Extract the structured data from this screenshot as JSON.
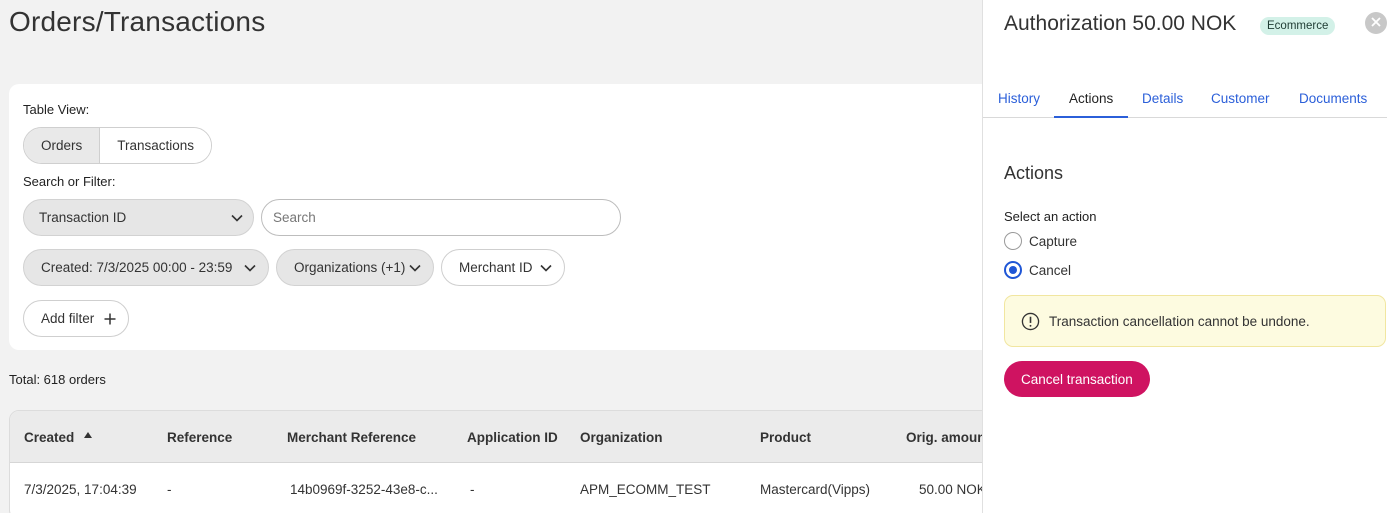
{
  "page": {
    "title": "Orders/Transactions"
  },
  "filters": {
    "table_view_label": "Table View:",
    "view_options": [
      "Orders",
      "Transactions"
    ],
    "search_label": "Search or Filter:",
    "field_select_value": "Transaction ID",
    "search_placeholder": "Search",
    "created_filter": "Created: 7/3/2025 00:00 - 23:59",
    "organizations_filter": "Organizations (+1)",
    "merchant_filter": "Merchant ID",
    "add_filter": "Add filter"
  },
  "summary": {
    "total": "Total: 618 orders"
  },
  "table": {
    "columns": [
      "Created",
      "Reference",
      "Merchant Reference",
      "Application ID",
      "Organization",
      "Product",
      "Orig. amoun"
    ],
    "rows": [
      [
        "7/3/2025, 17:04:39",
        "-",
        "14b0969f-3252-43e8-c...",
        "-",
        "APM_ECOMM_TEST",
        "Mastercard(Vipps)",
        "50.00 NOK"
      ]
    ]
  },
  "panel": {
    "title": "Authorization 50.00 NOK",
    "badge": "Ecommerce",
    "tabs": [
      "History",
      "Actions",
      "Details",
      "Customer",
      "Documents"
    ],
    "active_tab": "Actions",
    "section_title": "Actions",
    "select_label": "Select an action",
    "options": [
      "Capture",
      "Cancel"
    ],
    "selected_option": "Cancel",
    "warning_text": "Transaction cancellation cannot be undone.",
    "cancel_button": "Cancel transaction"
  },
  "colors": {
    "accent_blue": "#2b5fd9",
    "cancel_button": "#cf1361",
    "badge_bg": "#d3f1e8",
    "warning_bg": "#fdfbe0"
  },
  "icons": [
    "chevron-down-icon",
    "plus-icon",
    "sort-ascending-icon",
    "close-icon",
    "warning-info-icon"
  ]
}
